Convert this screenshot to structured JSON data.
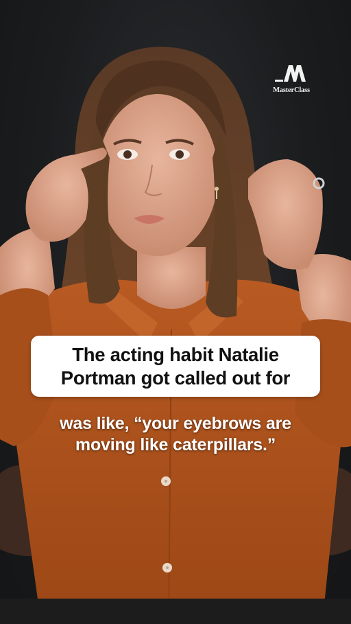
{
  "brand": {
    "name": "MasterClass",
    "icon": "masterclass-logo-icon"
  },
  "title_card": {
    "line1": "The acting habit Natalie",
    "line2": "Portman got called out for"
  },
  "caption": {
    "line1": "was like, “your eyebrows are",
    "line2": "moving like caterpillars.”"
  },
  "colors": {
    "background": "#1b1c1e",
    "shirt": "#b4561f",
    "title_box": "#ffffff",
    "title_text": "#111111",
    "caption_text": "#ffffff"
  }
}
